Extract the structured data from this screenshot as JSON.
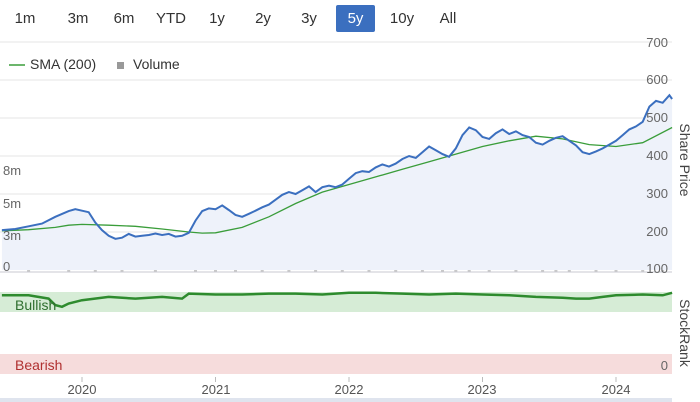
{
  "range_selector": {
    "buttons": [
      "1m",
      "3m",
      "6m",
      "YTD",
      "1y",
      "2y",
      "3y",
      "5y",
      "10y",
      "All"
    ],
    "active": "5y"
  },
  "legend": {
    "sma_label": "SMA (200)",
    "volume_label": "Volume"
  },
  "chart_data": {
    "type": "line",
    "x_unit": "year",
    "x_ticks": [
      "2020",
      "2021",
      "2022",
      "2023",
      "2024"
    ],
    "price_axis": {
      "label": "Share Price",
      "ticks": [
        100,
        200,
        300,
        400,
        500,
        600,
        700
      ],
      "ylim": [
        100,
        700
      ]
    },
    "volume_axis": {
      "ticks": [
        "0",
        "3m",
        "5m",
        "8m"
      ]
    },
    "stockrank_axis": {
      "label": "StockRank",
      "top_label": "Bullish",
      "bottom_label": "Bearish",
      "zero_label": "0"
    },
    "series": [
      {
        "name": "",
        "color": "#3b6fbf",
        "x": [
          2019.4,
          2019.5,
          2019.6,
          2019.7,
          2019.8,
          2019.9,
          2019.95,
          2020.0,
          2020.05,
          2020.1,
          2020.15,
          2020.2,
          2020.25,
          2020.3,
          2020.35,
          2020.4,
          2020.45,
          2020.5,
          2020.55,
          2020.6,
          2020.65,
          2020.7,
          2020.75,
          2020.8,
          2020.85,
          2020.9,
          2020.95,
          2021.0,
          2021.05,
          2021.1,
          2021.15,
          2021.2,
          2021.25,
          2021.3,
          2021.35,
          2021.4,
          2021.45,
          2021.5,
          2021.55,
          2021.6,
          2021.65,
          2021.7,
          2021.75,
          2021.8,
          2021.85,
          2021.9,
          2021.95,
          2022.0,
          2022.05,
          2022.1,
          2022.15,
          2022.2,
          2022.25,
          2022.3,
          2022.35,
          2022.4,
          2022.45,
          2022.5,
          2022.55,
          2022.6,
          2022.65,
          2022.7,
          2022.75,
          2022.8,
          2022.85,
          2022.9,
          2022.95,
          2023.0,
          2023.05,
          2023.1,
          2023.15,
          2023.2,
          2023.25,
          2023.3,
          2023.35,
          2023.4,
          2023.45,
          2023.5,
          2023.55,
          2023.6,
          2023.65,
          2023.7,
          2023.75,
          2023.8,
          2023.85,
          2023.9,
          2023.95,
          2024.0,
          2024.05,
          2024.1,
          2024.15,
          2024.2,
          2024.25,
          2024.3,
          2024.35,
          2024.4,
          2024.42
        ],
        "values": [
          205,
          208,
          215,
          222,
          240,
          255,
          260,
          256,
          252,
          225,
          205,
          190,
          182,
          185,
          195,
          188,
          190,
          192,
          196,
          192,
          195,
          188,
          190,
          198,
          230,
          255,
          262,
          260,
          270,
          258,
          245,
          240,
          248,
          256,
          265,
          272,
          285,
          298,
          305,
          300,
          310,
          320,
          305,
          318,
          322,
          318,
          325,
          340,
          355,
          360,
          358,
          370,
          378,
          372,
          380,
          392,
          400,
          395,
          410,
          425,
          415,
          405,
          398,
          420,
          455,
          475,
          468,
          450,
          445,
          460,
          470,
          458,
          465,
          455,
          450,
          435,
          430,
          440,
          448,
          452,
          440,
          428,
          410,
          405,
          412,
          420,
          430,
          440,
          455,
          470,
          478,
          490,
          530,
          545,
          540,
          560,
          550
        ]
      },
      {
        "name": "SMA (200)",
        "color": "#3a9d3a",
        "x": [
          2019.4,
          2019.6,
          2019.8,
          2019.9,
          2020.0,
          2020.2,
          2020.4,
          2020.6,
          2020.8,
          2020.9,
          2021.0,
          2021.2,
          2021.4,
          2021.6,
          2021.8,
          2022.0,
          2022.2,
          2022.4,
          2022.6,
          2022.8,
          2023.0,
          2023.2,
          2023.4,
          2023.6,
          2023.8,
          2024.0,
          2024.2,
          2024.42
        ],
        "values": [
          203,
          206,
          212,
          218,
          220,
          218,
          215,
          208,
          200,
          197,
          198,
          212,
          240,
          275,
          305,
          325,
          345,
          365,
          385,
          405,
          425,
          440,
          452,
          445,
          430,
          425,
          435,
          475
        ]
      },
      {
        "name": "Volume",
        "color": "#c8c8c8",
        "x": [
          2019.6,
          2019.9,
          2020.1,
          2020.3,
          2020.55,
          2020.85,
          2021.0,
          2021.15,
          2021.35,
          2021.55,
          2021.75,
          2021.95,
          2022.15,
          2022.35,
          2022.55,
          2022.7,
          2022.8,
          2022.9,
          2023.05,
          2023.25,
          2023.45,
          2023.55,
          2023.65,
          2023.85,
          2024.0,
          2024.2,
          2024.35
        ],
        "values": [
          0.6,
          0.8,
          1.0,
          1.2,
          0.8,
          0.9,
          1.0,
          1.3,
          1.1,
          1.0,
          1.4,
          1.0,
          0.9,
          1.2,
          0.9,
          1.0,
          1.3,
          3.5,
          1.6,
          1.2,
          1.5,
          1.0,
          3.8,
          1.6,
          1.3,
          1.1,
          2.0
        ]
      }
    ],
    "stockrank": {
      "x": [
        2019.4,
        2019.6,
        2019.75,
        2019.8,
        2019.85,
        2019.9,
        2020.0,
        2020.2,
        2020.4,
        2020.6,
        2020.75,
        2020.8,
        2021.0,
        2021.2,
        2021.4,
        2021.6,
        2021.8,
        2022.0,
        2022.2,
        2022.4,
        2022.6,
        2022.8,
        2023.0,
        2023.2,
        2023.4,
        2023.6,
        2023.7,
        2023.8,
        2023.9,
        2024.0,
        2024.2,
        2024.35,
        2024.42
      ],
      "values": [
        96,
        96,
        92,
        84,
        82,
        86,
        90,
        94,
        92,
        94,
        92,
        98,
        97,
        97,
        98,
        98,
        97,
        99,
        99,
        98,
        97,
        98,
        97,
        96,
        94,
        93,
        92,
        92,
        94,
        96,
        97,
        96,
        99
      ]
    }
  }
}
